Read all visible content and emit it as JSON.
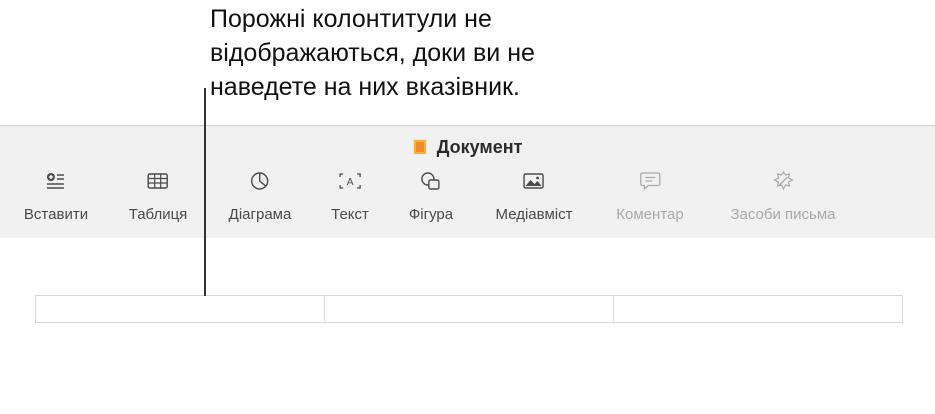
{
  "callout": {
    "text": "Порожні колонтитули не\nвідображаються, доки ви не\nнаведете на них вказівник."
  },
  "window": {
    "title": "Документ"
  },
  "toolbar": {
    "insert_label": "Вставити",
    "table_label": "Таблиця",
    "chart_label": "Діаграма",
    "text_label": "Текст",
    "shape_label": "Фігура",
    "media_label": "Медіавміст",
    "comment_label": "Коментар",
    "writing_tools_label": "Засоби письма"
  },
  "icons": {
    "insert": "insert-icon",
    "table": "table-icon",
    "chart": "chart-icon",
    "text": "text-box-icon",
    "shape": "shape-icon",
    "media": "media-icon",
    "comment": "comment-icon",
    "writing_tools": "writing-tools-icon"
  },
  "colors": {
    "toolbar_bg": "#f1f1f1",
    "enabled_label": "#4a4a4a",
    "disabled_label": "#a9a9a9",
    "doc_icon": "#f3b23a"
  },
  "header_fields": [
    "",
    "",
    ""
  ]
}
